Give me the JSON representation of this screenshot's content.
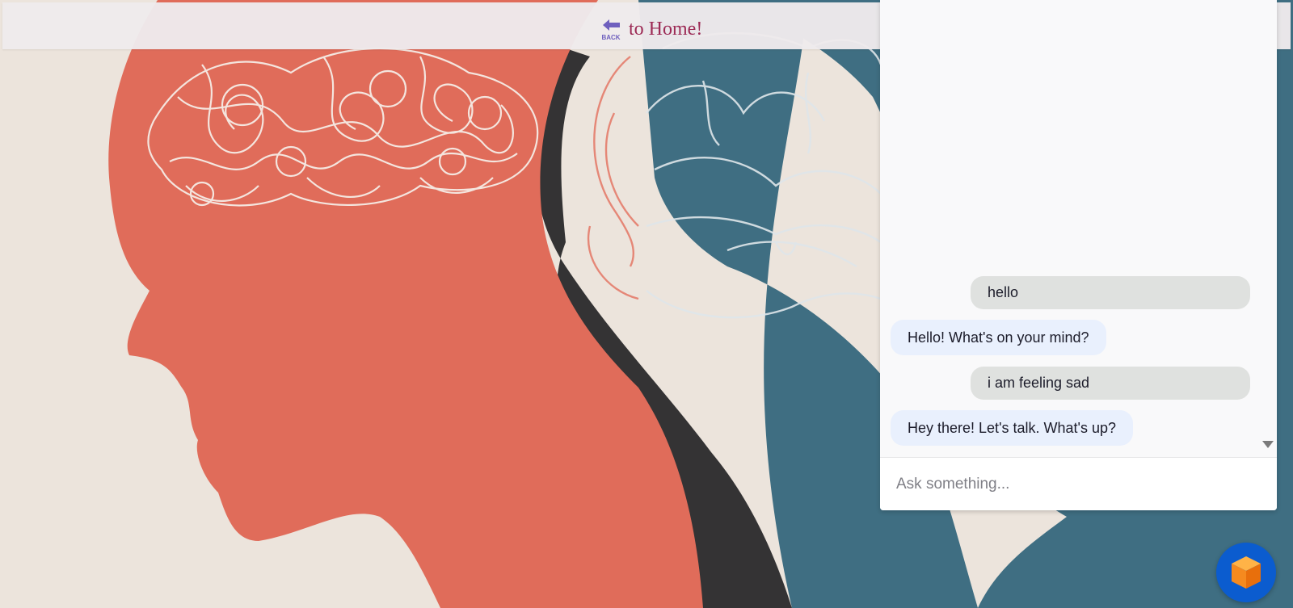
{
  "topbar": {
    "back_icon_label": "BACK",
    "back_text": "to Home!"
  },
  "chat": {
    "messages": [
      {
        "role": "user",
        "text": "hello"
      },
      {
        "role": "bot",
        "text": "Hello! What's on your mind?"
      },
      {
        "role": "user",
        "text": "i am feeling sad"
      },
      {
        "role": "bot",
        "text": "Hey there! Let's talk. What's up?"
      }
    ],
    "input_placeholder": "Ask something...",
    "input_value": ""
  },
  "icons": {
    "back": "back-arrow-icon",
    "scroll": "scroll-down-icon",
    "launcher": "cube-icon"
  },
  "colors": {
    "brand_blue": "#0b5ccf",
    "launcher_orange": "#f58a1f",
    "back_text": "#9c2a55",
    "user_bubble": "#dfe1df",
    "bot_bubble": "#e9f0fd"
  }
}
